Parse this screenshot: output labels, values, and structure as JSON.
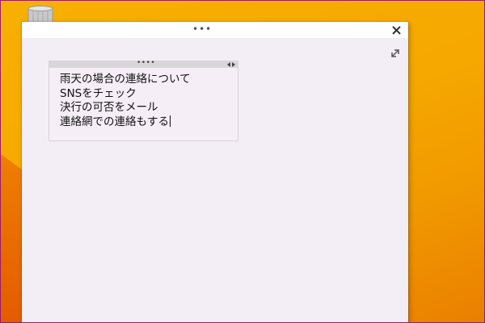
{
  "window": {
    "drag_handle": "•••",
    "close_icon": "close-icon",
    "expand_icon": "expand-icon"
  },
  "note": {
    "grip": "••••",
    "lines": [
      "雨天の場合の連絡について",
      "SNSをチェック",
      "決行の可否をメール",
      "連絡網での連絡もする"
    ]
  },
  "colors": {
    "desktop": "#f6a800",
    "window_bg": "#f3eef6",
    "titlebar_bg": "#ffffff",
    "note_bar": "#d9d6da",
    "frame_border": "#9c1a6b"
  },
  "desktop": {
    "icon": "recycle-bin-icon"
  }
}
